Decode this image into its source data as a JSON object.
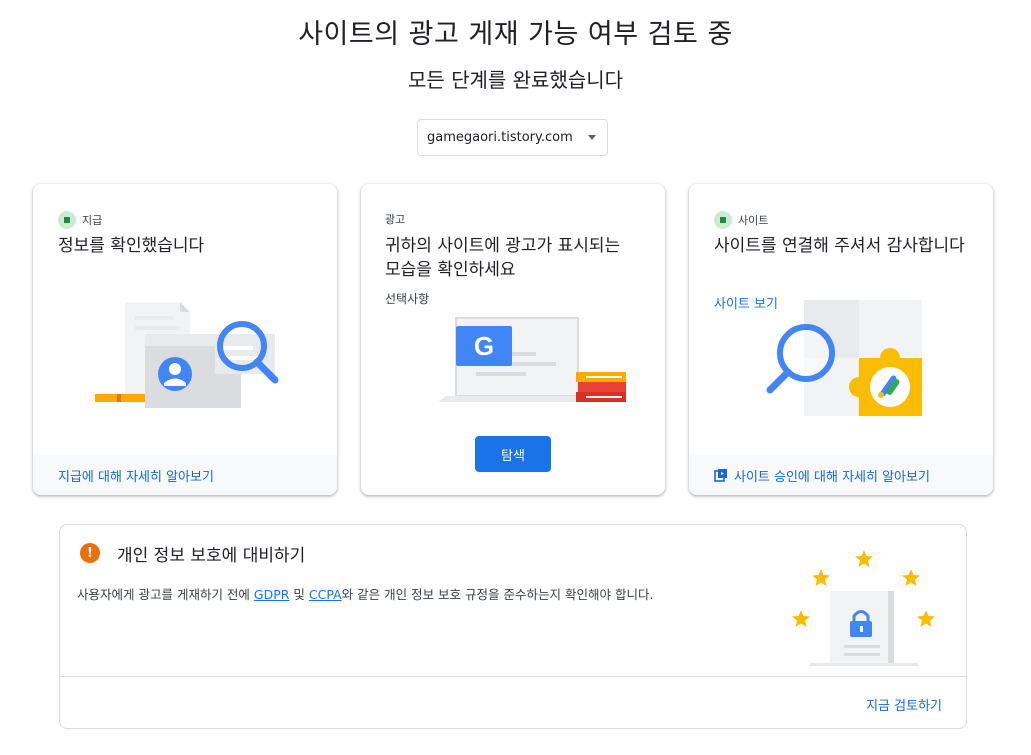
{
  "header": {
    "title": "사이트의 광고 게재 가능 여부 검토 중",
    "subtitle": "모든 단계를 완료했습니다"
  },
  "site_selector": {
    "value": "gamegaori.tistory.com"
  },
  "cards": [
    {
      "tag": "지급",
      "heading": "정보를 확인했습니다",
      "footer_link": "지급에 대해 자세히 알아보기",
      "status_color": "#1e8e3e"
    },
    {
      "tag": "광고",
      "heading": "귀하의 사이트에 광고가 표시되는 모습을 확인하세요",
      "optional": "선택사항",
      "button_label": "탐색",
      "illustration_letter": "G"
    },
    {
      "tag": "사이트",
      "heading": "사이트를 연결해 주셔서 감사합니다",
      "link": "사이트 보기",
      "footer_link": "사이트 승인에 대해 자세히 알아보기",
      "status_color": "#1e8e3e"
    }
  ],
  "privacy": {
    "icon": "!",
    "title": "개인 정보 보호에 대비하기",
    "text_before": "사용자에게 광고를 게재하기 전에 ",
    "link_gdpr": "GDPR",
    "text_and": " 및 ",
    "link_ccpa": "CCPA",
    "text_after": "와 같은 개인 정보 보호 규정을 준수하는지 확인해야 합니다.",
    "review_link": "지금 검토하기"
  },
  "colors": {
    "accent": "#1a73e8",
    "success": "#1e8e3e",
    "warning": "#e8710a",
    "star": "#fbbc04"
  }
}
